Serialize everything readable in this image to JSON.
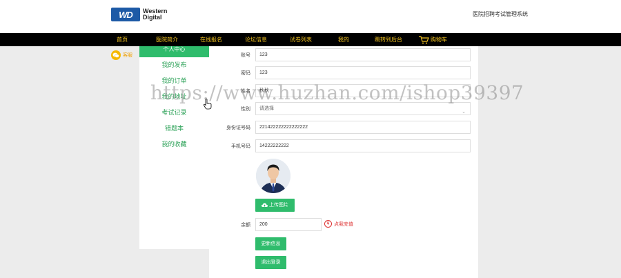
{
  "header": {
    "logo_badge": "WD",
    "logo_line1": "Western",
    "logo_line2": "Digital",
    "site_title": "医院招聘考试管理系统"
  },
  "nav": {
    "items": [
      "首页",
      "医院简介",
      "在线报名",
      "论坛信息",
      "试卷列表",
      "我的",
      "跳转到后台"
    ],
    "cart": "购物车"
  },
  "wechat_label": "客服",
  "sidebar": {
    "title": "个人中心",
    "items": [
      "我的发布",
      "我的订单",
      "我的地址",
      "考试记录",
      "错题本",
      "我的收藏"
    ]
  },
  "form": {
    "account_label": "账号",
    "account_value": "123",
    "password_label": "密码",
    "password_value": "123",
    "name_label": "姓名",
    "name_value": "秋秋",
    "gender_label": "性别",
    "gender_placeholder": "请选择",
    "idcard_label": "身份证号码",
    "idcard_value": "221422222222222222",
    "phone_label": "手机号码",
    "phone_value": "14222222222",
    "upload_label": "上传图片",
    "balance_label": "余额",
    "balance_value": "200",
    "recharge_label": "点我充值",
    "update_label": "更新信息",
    "logout_label": "退出登录"
  },
  "watermark": "https://www.huzhan.com/ishop39397",
  "colors": {
    "nav_bg": "#000000",
    "nav_text": "#f0c020",
    "accent_green": "#2fbc6c",
    "recharge_red": "#dd3333"
  }
}
